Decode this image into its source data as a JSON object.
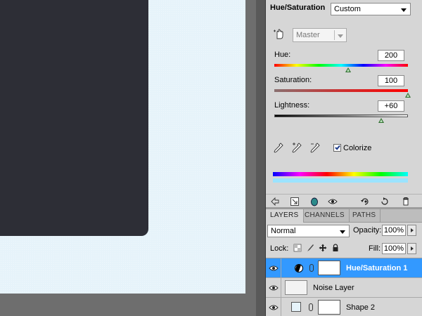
{
  "adjustments": {
    "title": "Hue/Saturation",
    "preset": "Custom",
    "channel": "Master",
    "hue": {
      "label": "Hue:",
      "value": "200",
      "fraction": 0.55
    },
    "saturation": {
      "label": "Saturation:",
      "value": "100",
      "fraction": 1.0
    },
    "lightness": {
      "label": "Lightness:",
      "value": "+60",
      "fraction": 0.8
    },
    "colorize": {
      "label": "Colorize",
      "checked": true
    }
  },
  "tabs": [
    {
      "label": "LAYERS"
    },
    {
      "label": "CHANNELS"
    },
    {
      "label": "PATHS"
    }
  ],
  "layer_options": {
    "blend_mode": "Normal",
    "opacity_label": "Opacity:",
    "opacity": "100%",
    "lock_label": "Lock:",
    "fill_label": "Fill:",
    "fill": "100%"
  },
  "layers": [
    {
      "name": "Hue/Saturation 1"
    },
    {
      "name": "Noise Layer"
    },
    {
      "name": "Shape 2"
    }
  ],
  "colors": {
    "selection": "#3399ff",
    "canvas_bg": "#e6f3fa",
    "dark_shape": "#2d2e36"
  }
}
